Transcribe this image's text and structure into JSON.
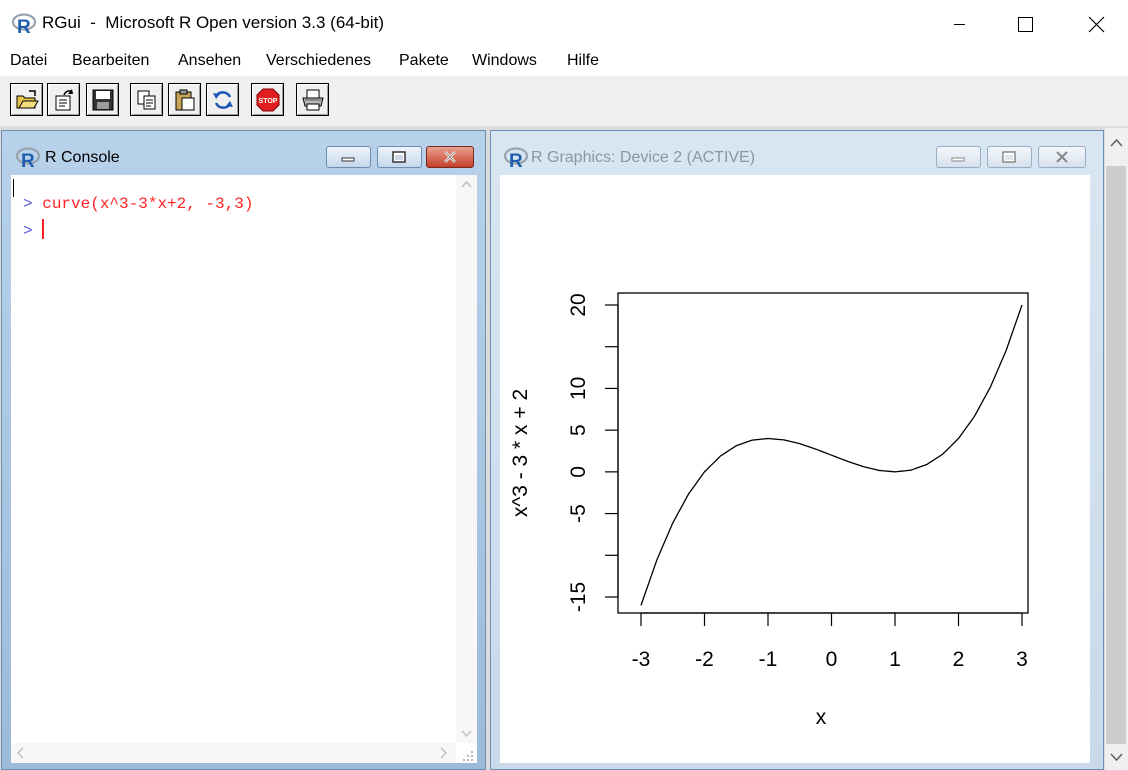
{
  "window": {
    "title": "RGui  -  Microsoft R Open version 3.3 (64-bit)"
  },
  "menu": [
    "Datei",
    "Bearbeiten",
    "Ansehen",
    "Verschiedenes",
    "Pakete",
    "Windows",
    "Hilfe"
  ],
  "toolbar": {
    "buttons": [
      "open-script-icon",
      "load-workspace-icon",
      "save-workspace-icon",
      "copy-icon",
      "paste-icon",
      "refresh-icon",
      "stop-icon",
      "print-icon"
    ],
    "stop_label": "STOP"
  },
  "console": {
    "title": "R Console",
    "prompt": ">",
    "lines": [
      "curve(x^3-3*x+2, -3,3)",
      ""
    ],
    "text_color": "#ff2222",
    "prompt_color": "#5b5bd6"
  },
  "graphics": {
    "title": "R Graphics: Device 2 (ACTIVE)"
  },
  "chart_data": {
    "type": "line",
    "title": "",
    "xlabel": "x",
    "ylabel": "x^3 - 3 * x + 2",
    "xlim": [
      -3,
      3
    ],
    "ylim": [
      -16,
      20
    ],
    "x_ticks": [
      -3,
      -2,
      -1,
      0,
      1,
      2,
      3
    ],
    "y_ticks": [
      -15,
      -10,
      -5,
      0,
      5,
      10,
      15,
      20
    ],
    "y_tick_labels": [
      "-15",
      "",
      "-5",
      "0",
      "5",
      "10",
      "",
      "20"
    ],
    "series": [
      {
        "x": [
          -3,
          -2.75,
          -2.5,
          -2.25,
          -2,
          -1.75,
          -1.5,
          -1.25,
          -1,
          -0.75,
          -0.5,
          -0.25,
          0,
          0.25,
          0.5,
          0.75,
          1,
          1.25,
          1.5,
          1.75,
          2,
          2.25,
          2.5,
          2.75,
          3
        ],
        "y": [
          -16,
          -10.55,
          -6.13,
          -2.64,
          0,
          1.89,
          3.13,
          3.8,
          4,
          3.83,
          3.38,
          2.73,
          2,
          1.27,
          0.63,
          0.17,
          0,
          0.2,
          0.88,
          2.11,
          4,
          6.64,
          10.13,
          14.55,
          20
        ]
      }
    ],
    "grid": false,
    "color": "#000000"
  }
}
